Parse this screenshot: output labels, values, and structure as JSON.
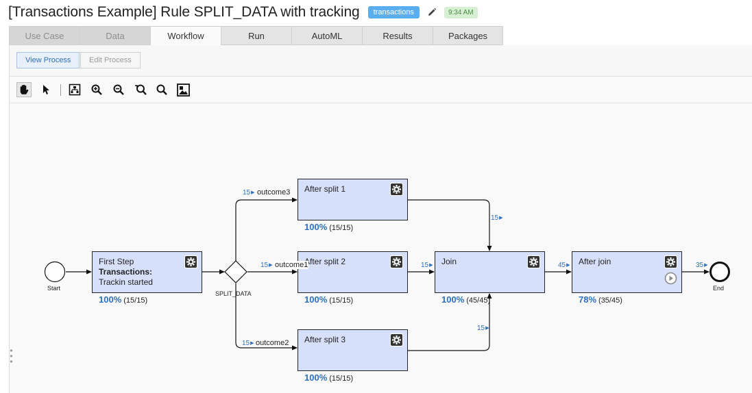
{
  "header": {
    "title": "[Transactions Example] Rule SPLIT_DATA with tracking",
    "tag": "transactions",
    "time": "9:34 AM"
  },
  "tabs": [
    {
      "label": "Use Case",
      "state": "disabled"
    },
    {
      "label": "Data",
      "state": "disabled"
    },
    {
      "label": "Workflow",
      "state": "active"
    },
    {
      "label": "Run",
      "state": "normal"
    },
    {
      "label": "AutoML",
      "state": "normal"
    },
    {
      "label": "Results",
      "state": "normal"
    },
    {
      "label": "Packages",
      "state": "normal"
    }
  ],
  "process_buttons": {
    "view": "View Process",
    "edit": "Edit Process"
  },
  "toolbar": {
    "tools": [
      "hand-tool-icon",
      "pointer-tool-icon",
      "auto-layout-icon",
      "zoom-in-icon",
      "zoom-out-icon",
      "zoom-reset-icon",
      "zoom-fit-icon",
      "overview-icon"
    ]
  },
  "diagram": {
    "start_label": "Start",
    "end_label": "End",
    "gateway_label": "SPLIT_DATA",
    "tasks": {
      "first_step": {
        "title": "First Step",
        "desc_bold": "Transactions:",
        "desc": " Trackin started",
        "percent": "100%",
        "ratio": "(15/15)"
      },
      "split1": {
        "title": "After split 1",
        "percent": "100%",
        "ratio": "(15/15)"
      },
      "split2": {
        "title": "After split 2",
        "percent": "100%",
        "ratio": "(15/15)"
      },
      "split3": {
        "title": "After split 3",
        "percent": "100%",
        "ratio": "(15/15)"
      },
      "join": {
        "title": "Join",
        "percent": "100%",
        "ratio": "(45/45)"
      },
      "after_join": {
        "title": "After join",
        "percent": "78%",
        "ratio": "(35/45)"
      }
    },
    "flows": {
      "outcome3": {
        "count": "15",
        "label": "outcome3"
      },
      "outcome1": {
        "count": "15",
        "label": "outcome1"
      },
      "outcome2": {
        "count": "15",
        "label": "outcome2"
      },
      "split1_to_join": "15",
      "split2_to_join": "15",
      "split3_to_join": "15",
      "join_to_after": "45",
      "after_to_end": "35"
    }
  },
  "colors": {
    "accent": "#2d6fc2",
    "task_fill": "#d7e0fb",
    "tag_badge": "#5aaef0",
    "time_badge": "#d7f0d4"
  }
}
